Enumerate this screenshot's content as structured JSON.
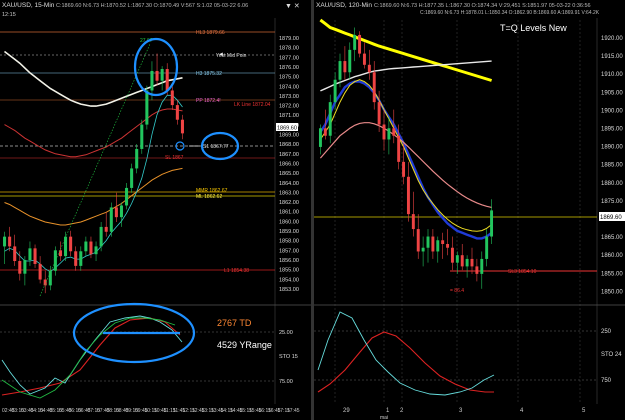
{
  "left_panel": {
    "title": "XAU/USD, 15-Min",
    "ohlc": "C:1869.60  N:6.73  H:1870.52  L:1867.30  O:1870.49  V:567  S:1.02  05-03-22  6.06",
    "level_labels": {
      "hl3": "HL3 1879.66",
      "yest_mid": "Yest Mid Poin",
      "h3": "H3 1875.32",
      "pp": "PP 1872.4!",
      "lk_line": "LK Line 1872.04",
      "ma": "MA 1867.77",
      "s1": "S1 1867.77",
      "sl": "SL 1867",
      "mmr": "MMR 1862.67",
      "ml": "ML 1862.62",
      "l1": "L1 1854.38"
    },
    "peak_label": "27.67",
    "last_price_tag": "1869.60",
    "price_ticks": [
      "1879.00",
      "1878.00",
      "1877.00",
      "1876.00",
      "1875.00",
      "1874.00",
      "1873.00",
      "1872.00",
      "1871.00",
      "1870.00",
      "1869.00",
      "1868.00",
      "1867.00",
      "1866.00",
      "1865.00",
      "1864.00",
      "1863.00",
      "1862.00",
      "1861.00",
      "1860.00",
      "1859.00",
      "1858.00",
      "1857.00",
      "1856.00",
      "1855.00",
      "1854.00",
      "1853.00"
    ],
    "time_ticks": [
      "02:45",
      "03:00",
      "03:15",
      "03:30",
      "03:45",
      "04:00",
      "04:15",
      "04:30",
      "04:45",
      "05:00",
      "05:15",
      "05:30",
      "05:45",
      "06:00",
      "06:15",
      "06:30",
      "06:45",
      "07:00",
      "07:15",
      "07:30",
      "07:45",
      "08:00",
      "08:15",
      "08:30",
      "08:45",
      "09:00",
      "09:15",
      "09:30",
      "09:45",
      "10:00",
      "10:15",
      "10:30",
      "10:45",
      "11:00",
      "11:15",
      "11:30",
      "11:45",
      "12:00",
      "12:15",
      "12:30",
      "12:45",
      "13:00",
      "13:15",
      "13:30",
      "13:45",
      "14:00",
      "14:15",
      "14:30",
      "14:45",
      "15:00",
      "15:15",
      "15:30",
      "15:45",
      "16:00",
      "16:15",
      "16:30",
      "16:45",
      "17:00",
      "17:15",
      "17:30",
      "17:45"
    ],
    "osc_ticks": [
      "25.00",
      "STO 15",
      "75.00"
    ],
    "annotation_td": "2767 TD",
    "annotation_yrange": "4529 YRange",
    "header_time": "12:15"
  },
  "right_panel": {
    "title": "XAU/USD, 120-Min",
    "ohlc": "C:1869.60  N:6.73  H:1877.35  L:1867.30  O:1874.34  V:29,451  S:1851.97  05-03-22  0:36:56",
    "ohlc_alt": "C:1869.60  N:6.73  H:1878.01  L:1850.34  O:1862.90  B:1869.60  A:1869.91  V:64.2K",
    "title_text": "T=Q Levels New",
    "level_labels": {
      "sl3": "SL3 1854.10",
      "low": "= 86.4"
    },
    "price_ticks": [
      "1920.00",
      "1915.00",
      "1910.00",
      "1905.00",
      "1900.00",
      "1895.00",
      "1890.00",
      "1885.00",
      "1880.00",
      "1875.00",
      "1870.00",
      "1865.00",
      "1860.00",
      "1855.00",
      "1850.00"
    ],
    "last_price_tag": "1869.60",
    "time_ticks": [
      "29",
      "1",
      "2",
      "3",
      "4",
      "5"
    ],
    "date_label": "mai",
    "osc_ticks": [
      "250",
      "STO 24",
      "750"
    ]
  },
  "colors": {
    "background": "#000000",
    "bull": "#22c55e",
    "bear": "#ef4444",
    "highlight": "#1e90ff",
    "yellow": "#ffff00",
    "blue_ma": "#1f3bd6"
  },
  "chart_data": [
    {
      "type": "candlestick",
      "title": "XAU/USD, 15-Min",
      "ylim": [
        1852.5,
        1880
      ],
      "series": [
        {
          "name": "candles",
          "ohlc": [
            [
              1858.0,
              1859.5,
              1856.2,
              1859.0
            ],
            [
              1859.0,
              1860.0,
              1857.5,
              1858.0
            ],
            [
              1858.0,
              1859.2,
              1856.0,
              1856.5
            ],
            [
              1856.5,
              1857.5,
              1854.5,
              1855.2
            ],
            [
              1855.2,
              1857.0,
              1854.0,
              1856.6
            ],
            [
              1856.6,
              1858.5,
              1856.0,
              1857.8
            ],
            [
              1857.8,
              1858.2,
              1855.8,
              1856.2
            ],
            [
              1856.2,
              1857.0,
              1854.2,
              1854.6
            ],
            [
              1854.6,
              1855.5,
              1853.2,
              1854.0
            ],
            [
              1854.0,
              1856.0,
              1853.5,
              1855.5
            ],
            [
              1855.5,
              1858.0,
              1855.0,
              1857.6
            ],
            [
              1857.6,
              1858.5,
              1856.5,
              1857.0
            ],
            [
              1857.0,
              1859.5,
              1856.5,
              1859.0
            ],
            [
              1859.0,
              1859.6,
              1857.0,
              1857.5
            ],
            [
              1857.5,
              1858.0,
              1855.5,
              1856.0
            ],
            [
              1856.0,
              1858.0,
              1855.5,
              1857.5
            ],
            [
              1857.5,
              1859.0,
              1857.0,
              1858.5
            ],
            [
              1858.5,
              1859.0,
              1856.8,
              1857.2
            ],
            [
              1857.2,
              1858.5,
              1856.5,
              1858.0
            ],
            [
              1858.0,
              1860.5,
              1857.5,
              1860.0
            ],
            [
              1860.0,
              1861.5,
              1859.0,
              1859.5
            ],
            [
              1859.5,
              1862.5,
              1859.0,
              1862.0
            ],
            [
              1862.0,
              1863.5,
              1860.5,
              1861.0
            ],
            [
              1861.0,
              1862.5,
              1860.0,
              1862.2
            ],
            [
              1862.2,
              1864.5,
              1861.8,
              1864.0
            ],
            [
              1864.0,
              1866.5,
              1863.5,
              1866.0
            ],
            [
              1866.0,
              1868.5,
              1865.5,
              1868.0
            ],
            [
              1868.0,
              1871.0,
              1867.5,
              1870.5
            ],
            [
              1870.5,
              1874.5,
              1870.0,
              1874.0
            ],
            [
              1874.0,
              1877.0,
              1873.0,
              1876.0
            ],
            [
              1876.0,
              1877.8,
              1874.5,
              1875.0
            ],
            [
              1875.0,
              1876.5,
              1874.0,
              1876.2
            ],
            [
              1876.2,
              1876.8,
              1873.5,
              1874.0
            ],
            [
              1874.0,
              1874.8,
              1872.0,
              1872.5
            ],
            [
              1872.5,
              1873.0,
              1870.5,
              1871.0
            ],
            [
              1871.0,
              1871.5,
              1869.0,
              1869.6
            ]
          ]
        },
        {
          "name": "ma_white",
          "values": [
            1878.0,
            1877.6,
            1877.2,
            1876.8,
            1876.3,
            1875.8,
            1875.4,
            1875.0,
            1874.6,
            1874.2,
            1873.9,
            1873.6,
            1873.3,
            1873.0,
            1872.8,
            1872.6,
            1872.5,
            1872.4,
            1872.4,
            1872.5,
            1872.6,
            1872.8,
            1873.0,
            1873.2,
            1873.4,
            1873.6,
            1873.8,
            1874.0,
            1874.2,
            1874.4,
            1874.6,
            1874.8,
            1875.0,
            1875.1,
            1875.2,
            1875.3
          ]
        },
        {
          "name": "ma_red",
          "values": [
            1870.5,
            1870.2,
            1869.9,
            1869.5,
            1869.1,
            1868.8,
            1868.5,
            1868.2,
            1867.9,
            1867.7,
            1867.5,
            1867.4,
            1867.3,
            1867.2,
            1867.2,
            1867.3,
            1867.4,
            1867.6,
            1867.8,
            1868.0,
            1868.2,
            1868.5,
            1868.8,
            1869.1,
            1869.5,
            1869.9,
            1870.3,
            1870.7,
            1871.1,
            1871.5,
            1871.8,
            1872.0,
            1872.1,
            1872.1,
            1872.0,
            1871.9
          ]
        },
        {
          "name": "ma_orange",
          "values": [
            1862.5,
            1862.3,
            1862.0,
            1861.7,
            1861.4,
            1861.1,
            1860.9,
            1860.7,
            1860.5,
            1860.4,
            1860.3,
            1860.2,
            1860.2,
            1860.3,
            1860.4,
            1860.5,
            1860.7,
            1860.9,
            1861.1,
            1861.3,
            1861.5,
            1861.8,
            1862.1,
            1862.4,
            1862.8,
            1863.2,
            1863.6,
            1864.0,
            1864.4,
            1864.8,
            1865.1,
            1865.4,
            1865.6,
            1865.8,
            1865.9,
            1866.0
          ]
        },
        {
          "name": "ma_cyan",
          "values": [
            1857.5,
            1857.8,
            1857.6,
            1857.0,
            1856.5,
            1856.5,
            1856.6,
            1856.2,
            1855.7,
            1855.4,
            1855.8,
            1856.3,
            1856.8,
            1856.9,
            1856.7,
            1856.7,
            1857.0,
            1857.2,
            1857.4,
            1858.0,
            1858.6,
            1859.4,
            1860.0,
            1860.6,
            1861.4,
            1862.4,
            1863.6,
            1865.0,
            1867.0,
            1869.5,
            1871.5,
            1872.8,
            1873.5,
            1873.5,
            1873.0,
            1872.3
          ]
        }
      ]
    },
    {
      "type": "candlestick",
      "title": "XAU/USD, 120-Min",
      "ylim": [
        1847,
        1922
      ],
      "series": [
        {
          "name": "candles",
          "ohlc": [
            [
              1888,
              1894,
              1886,
              1893
            ],
            [
              1893,
              1898,
              1890,
              1891
            ],
            [
              1891,
              1902,
              1889,
              1900
            ],
            [
              1900,
              1908,
              1898,
              1906
            ],
            [
              1906,
              1913,
              1904,
              1911
            ],
            [
              1911,
              1915,
              1906,
              1908
            ],
            [
              1908,
              1916,
              1906,
              1914
            ],
            [
              1914,
              1920,
              1911,
              1918
            ],
            [
              1918,
              1919,
              1912,
              1913
            ],
            [
              1913,
              1916,
              1909,
              1910
            ],
            [
              1910,
              1914,
              1906,
              1908
            ],
            [
              1908,
              1911,
              1898,
              1900
            ],
            [
              1900,
              1903,
              1892,
              1894
            ],
            [
              1894,
              1898,
              1887,
              1890
            ],
            [
              1890,
              1896,
              1886,
              1893
            ],
            [
              1893,
              1898,
              1889,
              1891
            ],
            [
              1891,
              1894,
              1882,
              1884
            ],
            [
              1884,
              1889,
              1878,
              1880
            ],
            [
              1880,
              1884,
              1868,
              1870
            ],
            [
              1870,
              1876,
              1864,
              1866
            ],
            [
              1866,
              1870,
              1858,
              1860
            ],
            [
              1860,
              1864,
              1856,
              1861
            ],
            [
              1861,
              1866,
              1857,
              1864
            ],
            [
              1864,
              1866,
              1858,
              1860
            ],
            [
              1860,
              1864,
              1857,
              1863
            ],
            [
              1863,
              1865,
              1858,
              1862
            ],
            [
              1862,
              1866,
              1859,
              1861
            ],
            [
              1861,
              1864,
              1855,
              1857
            ],
            [
              1857,
              1860,
              1854,
              1859
            ],
            [
              1859,
              1862,
              1855,
              1856
            ],
            [
              1856,
              1859,
              1853,
              1858
            ],
            [
              1858,
              1861,
              1854,
              1856
            ],
            [
              1856,
              1858,
              1852,
              1854
            ],
            [
              1854,
              1860,
              1850,
              1858
            ],
            [
              1858,
              1866,
              1856,
              1864
            ],
            [
              1864,
              1874,
              1862,
              1871
            ]
          ]
        },
        {
          "name": "yellow_ma",
          "values": [
            1922,
            1921,
            1920,
            1919.5,
            1919,
            1918.5,
            1918,
            1917.5,
            1917,
            1916.5,
            1916,
            1915.5,
            1915,
            1914.6,
            1914.2,
            1913.8,
            1913.4,
            1913,
            1912.6,
            1912.2,
            1911.8,
            1911.4,
            1911,
            1910.6,
            1910.2,
            1909.8,
            1909.4,
            1909,
            1908.6,
            1908.2,
            1907.8,
            1907.4,
            1907,
            1906.6,
            1906.2,
            1905.8
          ]
        },
        {
          "name": "white_ma",
          "values": [
            1903,
            1903.6,
            1904.2,
            1904.8,
            1905.3,
            1905.8,
            1906.3,
            1906.8,
            1907.2,
            1907.6,
            1908,
            1908.3,
            1908.5,
            1908.7,
            1908.9,
            1909,
            1909.1,
            1909.2,
            1909.3,
            1909.4,
            1909.5,
            1909.6,
            1909.7,
            1909.8,
            1909.9,
            1910,
            1910.1,
            1910.2,
            1910.3,
            1910.4,
            1910.5,
            1910.6,
            1910.7,
            1910.8,
            1910.9,
            1911
          ]
        },
        {
          "name": "blue_ma",
          "values": [
            1892,
            1894,
            1897,
            1900,
            1902,
            1904,
            1905,
            1905.5,
            1905.5,
            1905,
            1904,
            1902.5,
            1900.5,
            1898,
            1896,
            1894,
            1891.5,
            1889,
            1886,
            1883,
            1880,
            1877,
            1874.5,
            1872.5,
            1870.5,
            1869,
            1867.5,
            1866.5,
            1865.5,
            1865,
            1864.5,
            1864,
            1863.5,
            1863.5,
            1864,
            1865
          ]
        },
        {
          "name": "pink_ma",
          "values": [
            1885,
            1886.5,
            1888,
            1889.5,
            1891,
            1892,
            1893,
            1893.8,
            1894.3,
            1894.5,
            1894.5,
            1894.2,
            1893.7,
            1893,
            1892.2,
            1891.3,
            1890.3,
            1889.2,
            1888,
            1886.7,
            1885.4,
            1884.1,
            1882.8,
            1881.5,
            1880.3,
            1879.1,
            1878,
            1877,
            1876,
            1875.1,
            1874.3,
            1873.6,
            1873,
            1872.5,
            1872.1,
            1871.8
          ]
        },
        {
          "name": "yellow_thin_ma",
          "values": [
            1890,
            1892,
            1894,
            1897,
            1900,
            1902.5,
            1904.5,
            1905.5,
            1906,
            1905.5,
            1904.5,
            1902.8,
            1900.5,
            1898,
            1895.5,
            1893,
            1890.5,
            1888,
            1885,
            1882,
            1879,
            1876.5,
            1874.5,
            1872.8,
            1871.2,
            1869.8,
            1868.6,
            1867.6,
            1866.8,
            1866.2,
            1865.8,
            1865.5,
            1865.4,
            1865.6,
            1866.2,
            1867.2
          ]
        }
      ]
    }
  ]
}
